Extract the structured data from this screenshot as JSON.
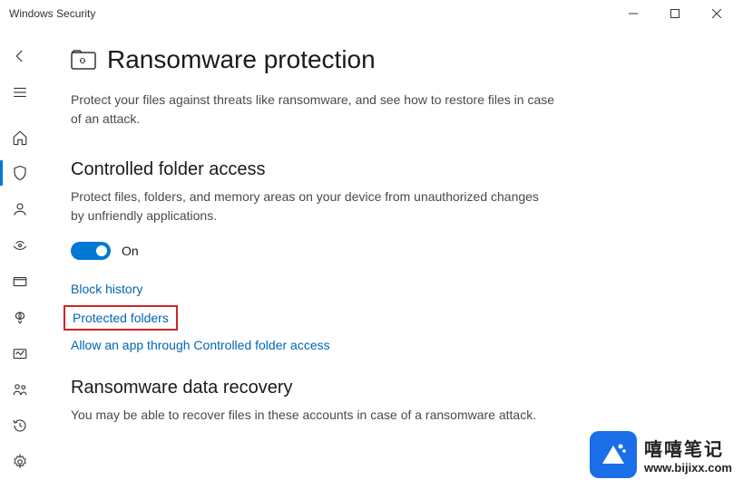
{
  "window": {
    "title": "Windows Security"
  },
  "sidebar": {
    "items": [
      {
        "name": "back-icon"
      },
      {
        "name": "menu-icon"
      },
      {
        "name": "home-icon"
      },
      {
        "name": "shield-icon",
        "selected": true
      },
      {
        "name": "account-icon"
      },
      {
        "name": "firewall-icon"
      },
      {
        "name": "app-browser-icon"
      },
      {
        "name": "device-security-icon"
      },
      {
        "name": "device-performance-icon"
      },
      {
        "name": "family-icon"
      },
      {
        "name": "history-icon"
      }
    ],
    "footer": {
      "name": "settings-icon"
    }
  },
  "page": {
    "title": "Ransomware protection",
    "description": "Protect your files against threats like ransomware, and see how to restore files in case of an attack.",
    "section1": {
      "heading": "Controlled folder access",
      "description": "Protect files, folders, and memory areas on your device from unauthorized changes by unfriendly applications.",
      "toggle_state": "On",
      "links": {
        "block_history": "Block history",
        "protected_folders": "Protected folders",
        "allow_app": "Allow an app through Controlled folder access"
      }
    },
    "section2": {
      "heading": "Ransomware data recovery",
      "description": "You may be able to recover files in these accounts in case of a ransomware attack."
    }
  },
  "watermark": {
    "cn": "嘻嘻笔记",
    "url": "www.bijixx.com"
  }
}
